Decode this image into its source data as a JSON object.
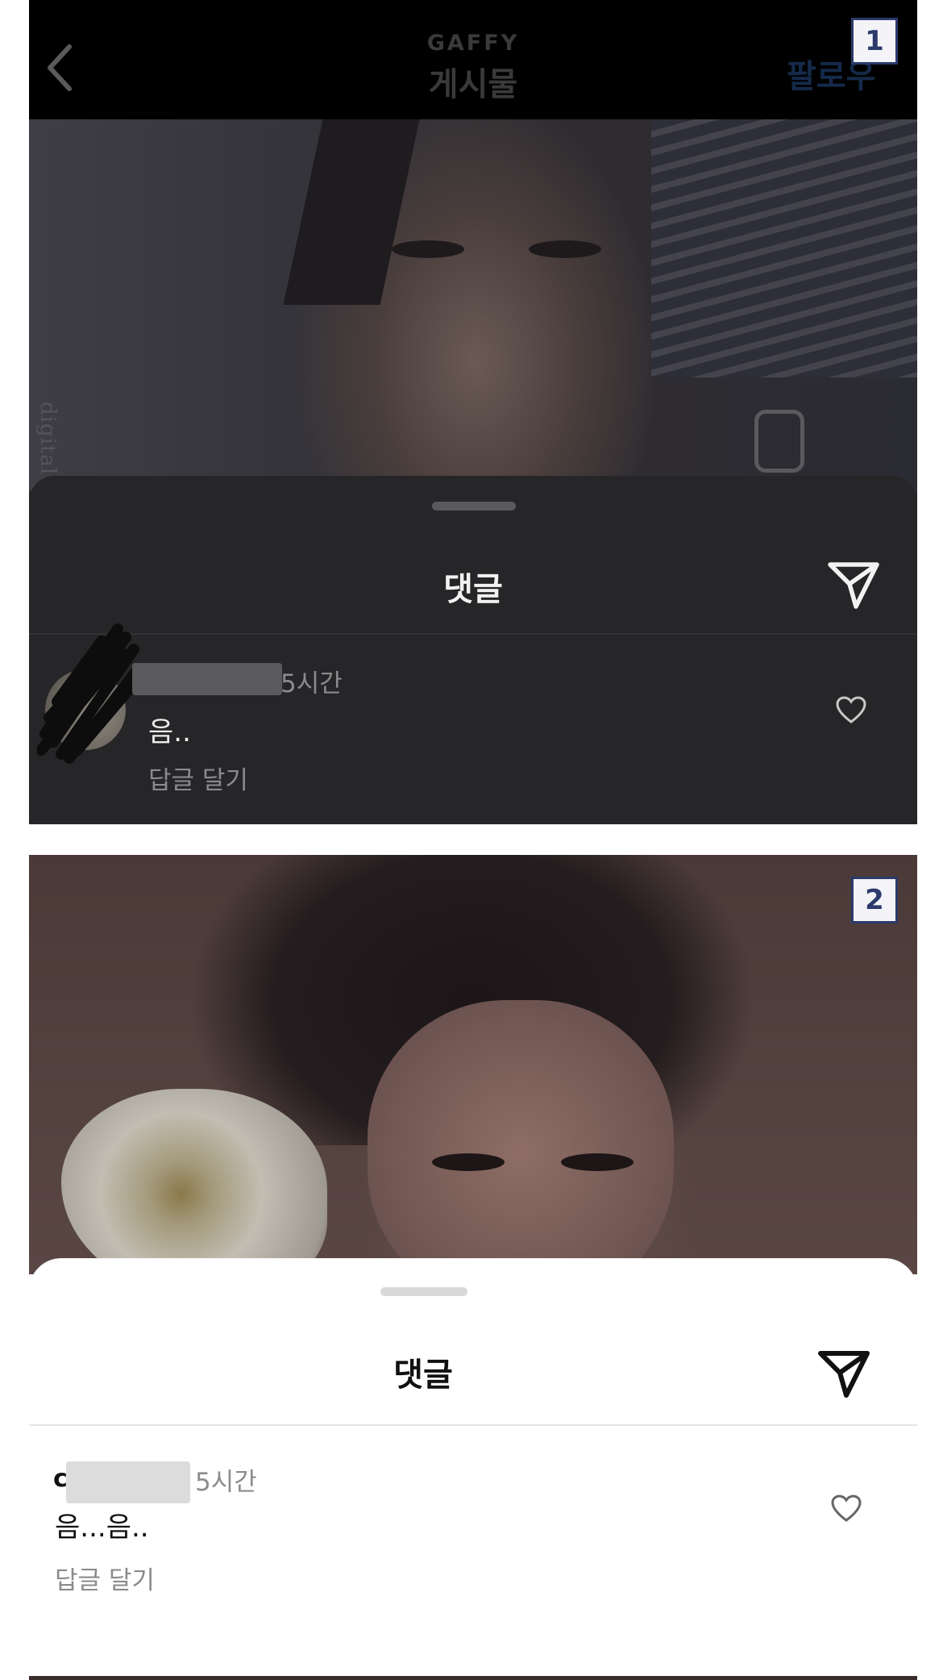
{
  "panel1": {
    "badge": "1",
    "header": {
      "subtitle": "GAFFY",
      "title": "게시물",
      "follow_label": "팔로우"
    },
    "photo_side_text": "digital edition",
    "sheet": {
      "title": "댓글",
      "comment": {
        "time": "5시간",
        "text": "음..",
        "reply_label": "답글 달기"
      }
    }
  },
  "panel2": {
    "badge": "2",
    "sheet": {
      "title": "댓글",
      "comment": {
        "name_initial": "c",
        "time": "5시간",
        "text": "음...음..",
        "reply_label": "답글 달기"
      }
    }
  },
  "colors": {
    "dark_sheet": "#262628",
    "light_sheet": "#ffffff",
    "badge_border": "#2b3a6b"
  },
  "icons": [
    "chevron-left-icon",
    "send-icon",
    "heart-icon"
  ]
}
